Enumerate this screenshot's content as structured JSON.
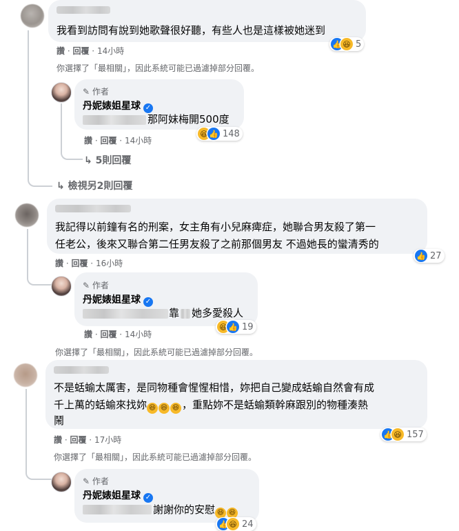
{
  "comments": [
    {
      "text": "我看到訪問有說到她歌聲很好聽，有些人也是這樣被她迷到",
      "like": "讚",
      "reply": "回覆",
      "time": "14小時",
      "reactions": {
        "icons": [
          "like-icon",
          "haha-icon"
        ],
        "count": "5"
      },
      "filter_note": "你選擇了「最相關」，因此系統可能已過濾掉部分回覆。",
      "author_reply": {
        "author_label": "作者",
        "name": "丹妮婊姐星球",
        "visible_text": "那阿妹梅開500度",
        "like": "讚",
        "reply": "回覆",
        "time": "14小時",
        "reactions": {
          "icons": [
            "haha-icon",
            "like-icon"
          ],
          "count": "148"
        },
        "more_replies": "5則回覆"
      },
      "view_more": "檢視另2則回覆"
    },
    {
      "text_lines": [
        "我記得以前鐘有名的刑案，女主角有小兒麻痺症，她聯合男友殺了第一",
        "任老公，後來又聯合第二任男友殺了之前那個男友 不過她長的蠻清秀的"
      ],
      "like": "讚",
      "reply": "回覆",
      "time": "16小時",
      "reactions": {
        "icons": [
          "like-icon"
        ],
        "count": "27"
      },
      "author_reply": {
        "author_label": "作者",
        "name": "丹妮婊姐星球",
        "visible_text_a": "靠",
        "visible_text_b": "她多愛殺人",
        "like": "讚",
        "reply": "回覆",
        "time": "14小時",
        "reactions": {
          "icons": [
            "haha-icon",
            "like-icon"
          ],
          "count": "19"
        }
      },
      "filter_note": "你選擇了「最相關」，因此系統可能已過濾掉部分回覆。"
    },
    {
      "text_lines": [
        "不是蛞蝓太厲害，是同物種會惺惺相惜，妳把自己變成蛞蝓自然會有成",
        "千上萬的蛞蝓來找妳",
        "，重點妳不是蛞蝓類幹麻跟別的物種湊熱",
        "鬧"
      ],
      "like": "讚",
      "reply": "回覆",
      "time": "17小時",
      "reactions": {
        "icons": [
          "like-icon",
          "haha-icon"
        ],
        "count": "157"
      },
      "filter_note": "你選擇了「最相關」，因此系統可能已過濾掉部分回覆。",
      "author_reply": {
        "author_label": "作者",
        "name": "丹妮婊姐星球",
        "visible_text": "謝謝你的安慰",
        "reactions": {
          "icons": [
            "like-icon",
            "haha-icon"
          ],
          "count": "24"
        }
      }
    }
  ],
  "icon_glyphs": {
    "like": "👍",
    "haha": "😆",
    "reply_arrow": "↳",
    "verified": "✓"
  },
  "colors": {
    "bubble": "#f0f2f5",
    "meta": "#65676b",
    "like_blue": "#1877f2",
    "haha_yellow": "#f7b928",
    "thread": "#ccd0d5"
  }
}
